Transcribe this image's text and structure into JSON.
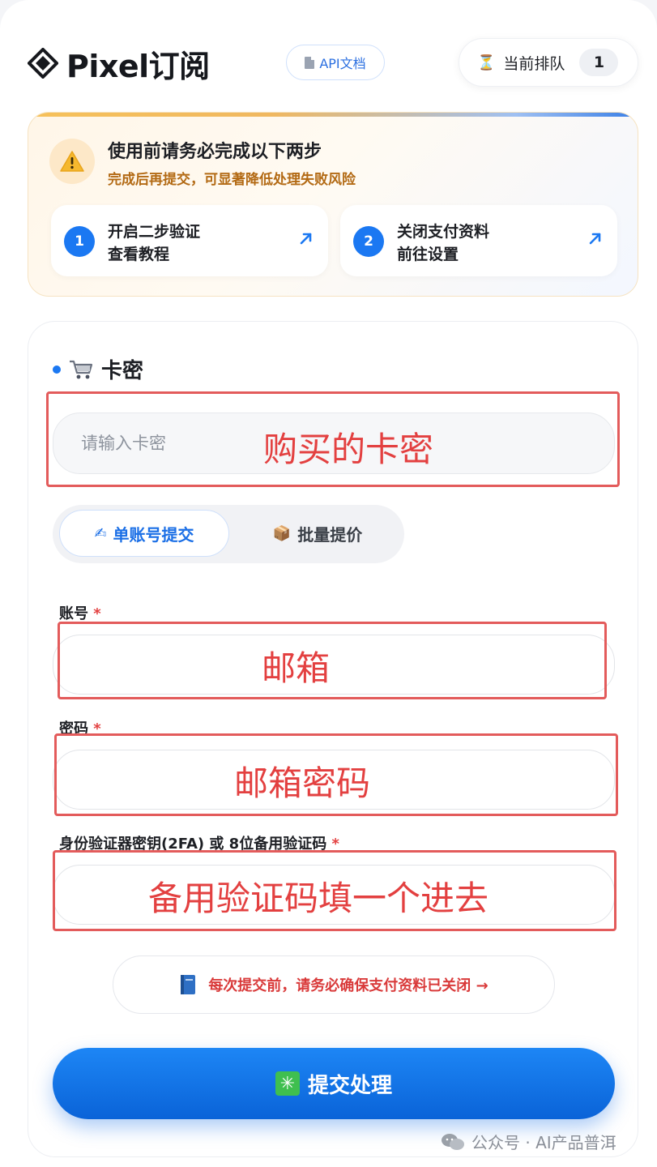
{
  "header": {
    "brand": "Pixel订阅",
    "api_doc_label": "API文档",
    "queue_label": "当前排队",
    "queue_count": "1"
  },
  "notice": {
    "title": "使用前请务必完成以下两步",
    "subtitle": "完成后再提交，可显著降低处理失败风险",
    "steps": [
      {
        "num": "1",
        "line1": "开启二步验证",
        "line2": "查看教程"
      },
      {
        "num": "2",
        "line1": "关闭支付资料",
        "line2": "前往设置"
      }
    ]
  },
  "form": {
    "card_label": "卡密",
    "card_placeholder": "请输入卡密",
    "tabs": [
      {
        "label": "单账号提交",
        "icon": "✍"
      },
      {
        "label": "批量提价",
        "icon": "📦"
      }
    ],
    "account_label": "账号",
    "password_label": "密码",
    "twofa_label": "身份验证器密钥(2FA) 或 8位备用验证码",
    "required_mark": "*",
    "reminder": "每次提交前，请务必确保支付资料已关闭 →",
    "submit_label": "提交处理"
  },
  "annotations": {
    "card": "购买的卡密",
    "account": "邮箱",
    "password": "邮箱密码",
    "twofa": "备用验证码填一个进去"
  },
  "watermark": "公众号 · AI产品普洱",
  "colors": {
    "accent": "#1b78f2",
    "annotation": "#e34040",
    "warning": "#b36a14"
  }
}
